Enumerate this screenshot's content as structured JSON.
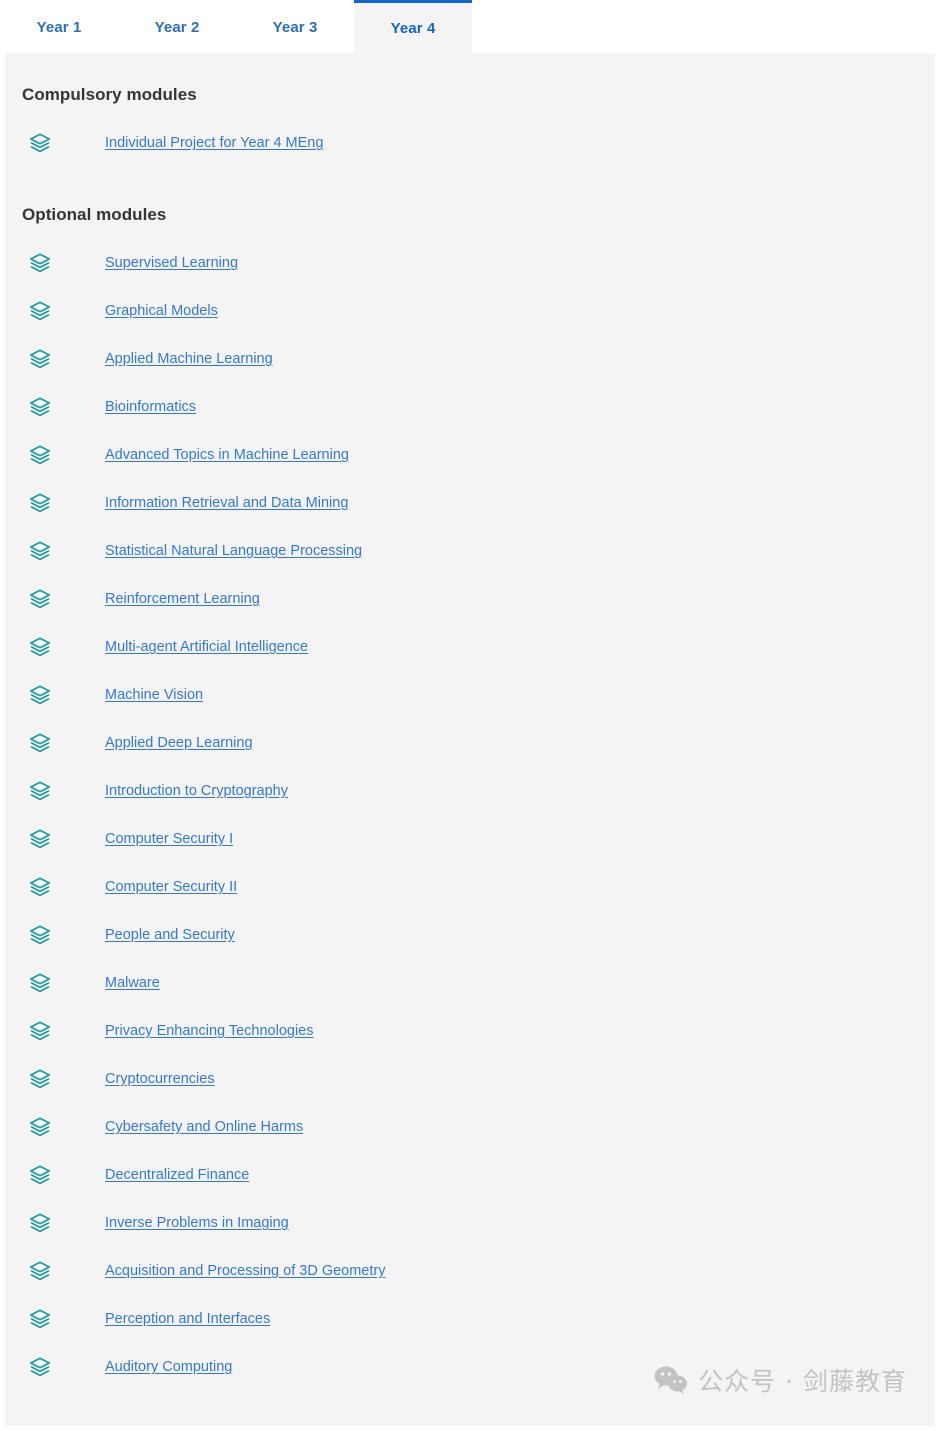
{
  "tabs": [
    {
      "label": "Year 1",
      "active": false
    },
    {
      "label": "Year 2",
      "active": false
    },
    {
      "label": "Year 3",
      "active": false
    },
    {
      "label": "Year 4",
      "active": true
    }
  ],
  "sections": {
    "compulsory": {
      "heading": "Compulsory modules",
      "modules": [
        "Individual Project for Year 4 MEng"
      ]
    },
    "optional": {
      "heading": "Optional modules",
      "modules": [
        "Supervised Learning",
        "Graphical Models",
        "Applied Machine Learning",
        "Bioinformatics",
        "Advanced Topics in Machine Learning",
        "Information Retrieval and Data Mining",
        "Statistical Natural Language Processing",
        "Reinforcement Learning",
        "Multi-agent Artificial Intelligence",
        "Machine Vision",
        "Applied Deep Learning",
        "Introduction to Cryptography",
        "Computer Security I",
        "Computer Security II",
        "People and Security",
        "Malware",
        "Privacy Enhancing Technologies",
        "Cryptocurrencies",
        "Cybersafety and Online Harms",
        "Decentralized Finance",
        "Inverse Problems in Imaging",
        "Acquisition and Processing of 3D Geometry",
        "Perception and Interfaces",
        "Auditory Computing"
      ]
    }
  },
  "watermark": {
    "icon": "wechat-icon",
    "text": "公众号 · 剑藤教育"
  },
  "icons": {
    "module": "layers-stack-icon"
  },
  "colors": {
    "link": "#3478d6",
    "tab_active": "#1565c8",
    "tab_inactive": "#2a6ebb",
    "icon_teal": "#1a9a9c",
    "panel_bg": "#f4f4f4",
    "heading": "#343434",
    "watermark": "#c3c3c3"
  }
}
